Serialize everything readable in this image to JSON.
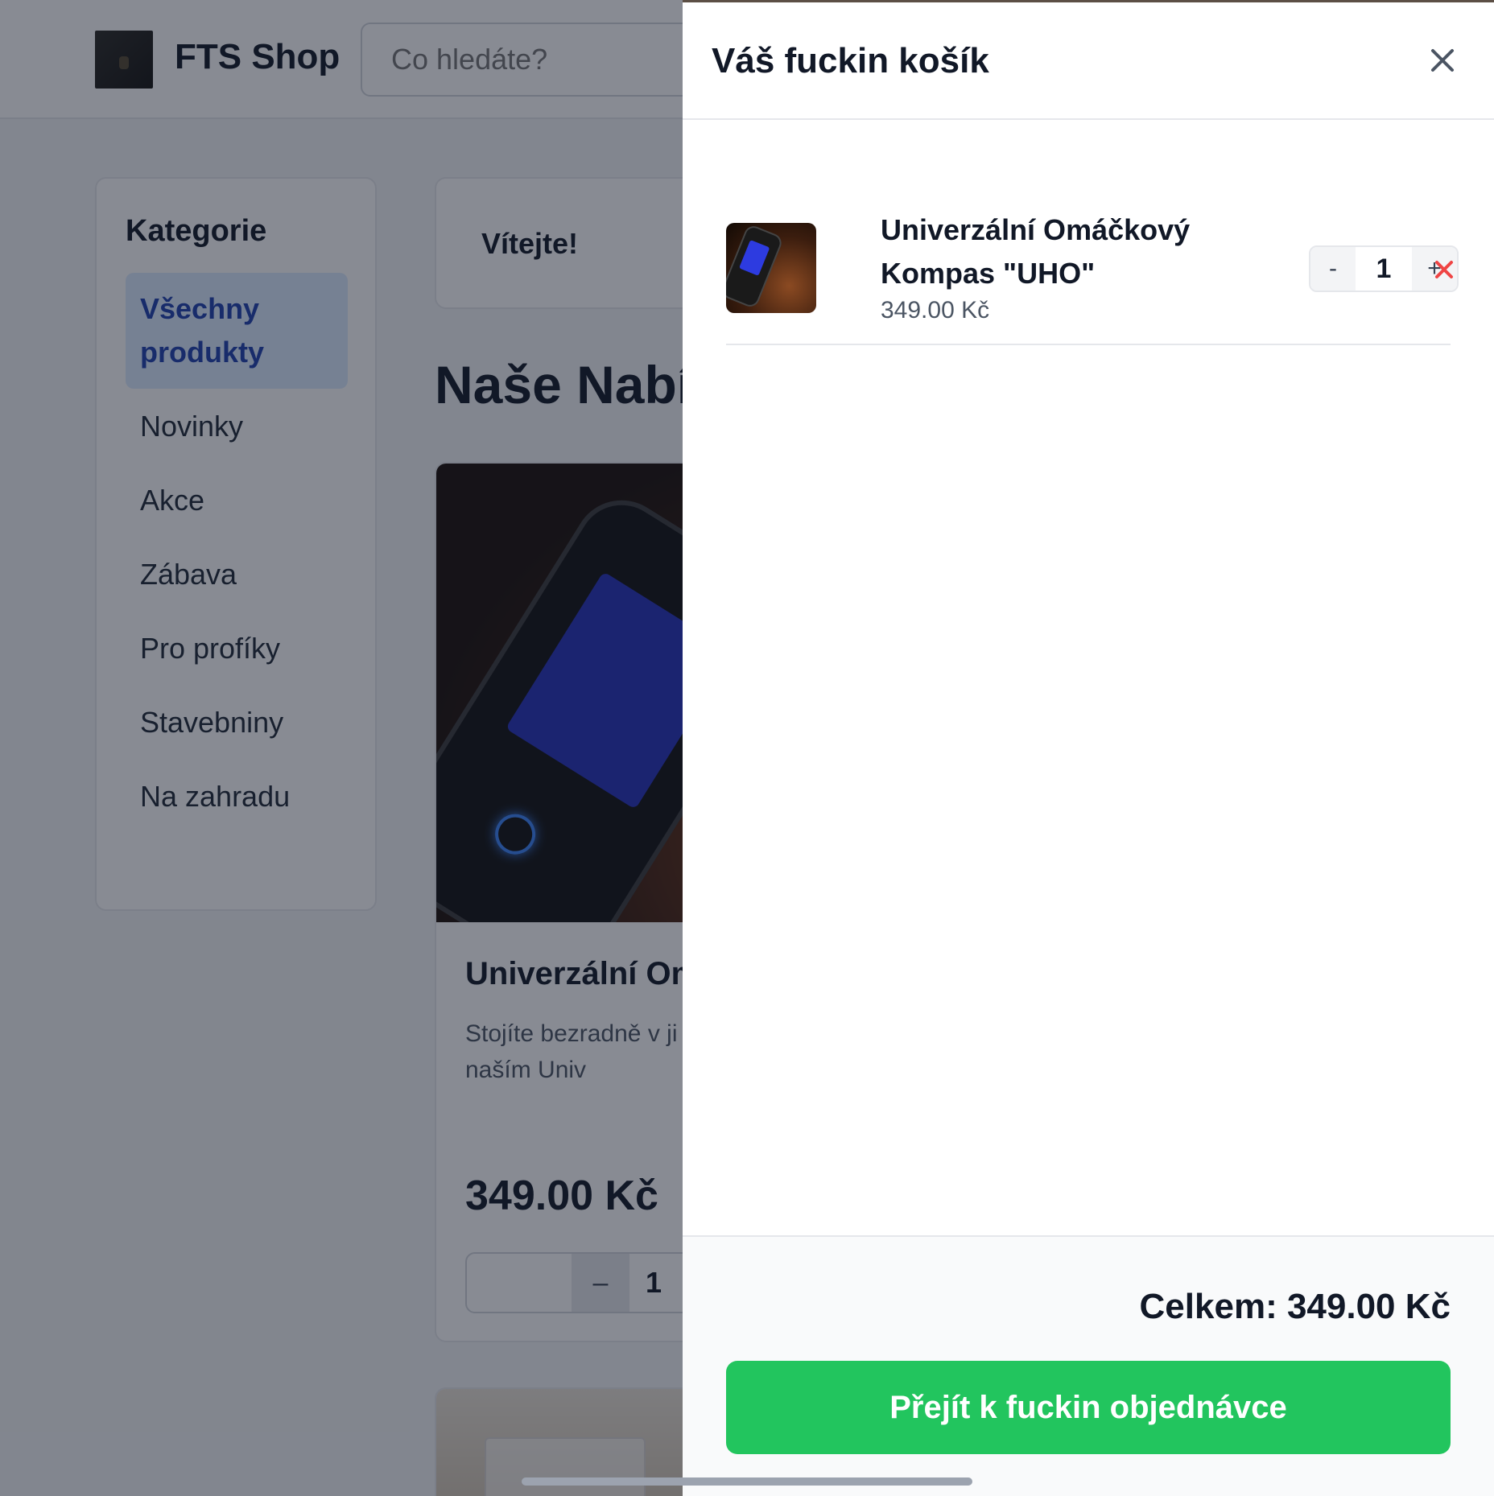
{
  "header": {
    "shop_name": "FTS Shop",
    "search_placeholder": "Co hledáte?"
  },
  "sidebar": {
    "title": "Kategorie",
    "items": [
      {
        "label": "Všechny produkty",
        "active": true
      },
      {
        "label": "Novinky"
      },
      {
        "label": "Akce"
      },
      {
        "label": "Zábava"
      },
      {
        "label": "Pro profíky"
      },
      {
        "label": "Stavebniny"
      },
      {
        "label": "Na zahradu"
      }
    ]
  },
  "main": {
    "welcome": "Vítejte!",
    "section_title": "Naše Nabí",
    "product": {
      "title": "Univerzální Om",
      "description": "Stojíte bezradně v ji která z těch hnědýc která? S naším Univ",
      "price": "349.00 Kč",
      "qty_minus": "–",
      "qty_value": "1"
    }
  },
  "cart": {
    "title": "Váš fuckin košík",
    "items": [
      {
        "name": "Univerzální Omáčkový Kompas \"UHO\"",
        "price": "349.00 Kč",
        "qty": "1",
        "dec_label": "-",
        "inc_label": "+"
      }
    ],
    "total": "Celkem: 349.00 Kč",
    "checkout_label": "Přejít k fuckin objednávce"
  },
  "colors": {
    "accent_green": "#22c55e",
    "remove_red": "#ef4444",
    "active_category_bg": "#dbeafe",
    "active_category_text": "#1e40af"
  },
  "icons": {
    "close": "close-icon",
    "remove": "remove-item-icon"
  }
}
